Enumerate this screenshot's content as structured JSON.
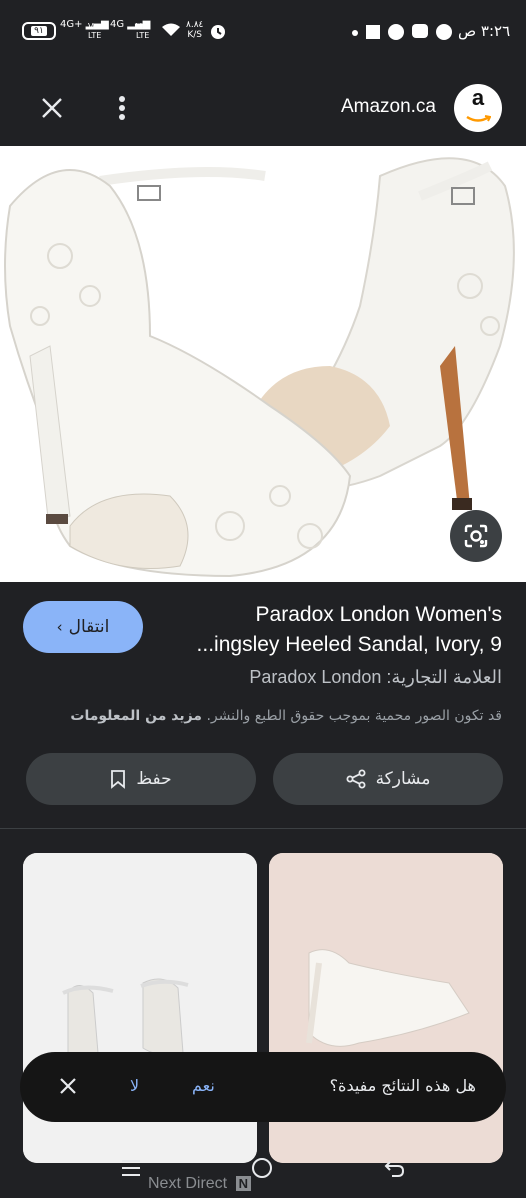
{
  "status_bar": {
    "time": "٣:٢٦ ص",
    "battery": "٩١",
    "signal_1": "4G+",
    "signal_1_sub": "Vo LTE",
    "signal_2": "4G",
    "signal_2_sub": "Vo LTE",
    "speed": "٨.٨٤",
    "speed_unit": "K/S"
  },
  "header": {
    "site_name": "Amazon.ca",
    "logo_letter": "a",
    "icons": [
      "close-icon",
      "more-vert-icon"
    ]
  },
  "product": {
    "title_line1": "Paradox London Women's",
    "title_line2": "...ingsley Heeled Sandal, Ivory, 9",
    "visit_label": "انتقال",
    "brand_line": "العلامة التجارية: Paradox London",
    "copyright_text": "قد تكون الصور محمية بموجب حقوق الطبع والنشر.",
    "more_info_link": "مزيد من المعلومات"
  },
  "actions": {
    "share_label": "مشاركة",
    "save_label": "حفظ"
  },
  "feedback": {
    "question": "هل هذه النتائج مفيدة؟",
    "yes": "نعم",
    "no": "لا"
  },
  "watermark": "Next Direct",
  "watermark_badge": "N",
  "colors": {
    "background": "#202124",
    "accent": "#8ab4f8",
    "pill": "#3c4043",
    "amazon_orange": "#ff9900"
  }
}
